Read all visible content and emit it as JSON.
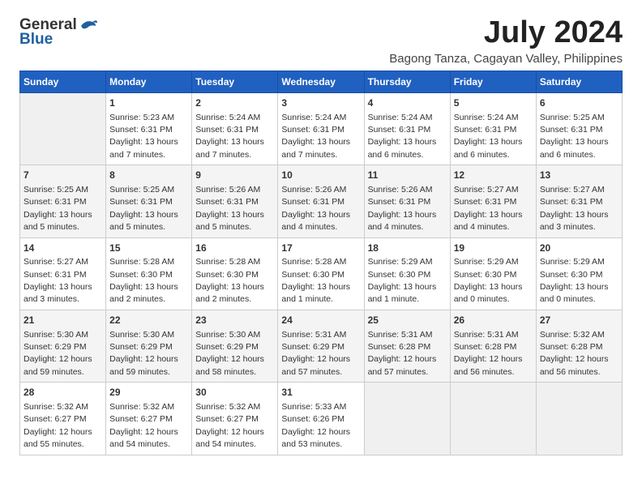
{
  "logo": {
    "general": "General",
    "blue": "Blue"
  },
  "title": "July 2024",
  "subtitle": "Bagong Tanza, Cagayan Valley, Philippines",
  "days_of_week": [
    "Sunday",
    "Monday",
    "Tuesday",
    "Wednesday",
    "Thursday",
    "Friday",
    "Saturday"
  ],
  "weeks": [
    [
      {
        "day": "",
        "sunrise": "",
        "sunset": "",
        "daylight": ""
      },
      {
        "day": "1",
        "sunrise": "Sunrise: 5:23 AM",
        "sunset": "Sunset: 6:31 PM",
        "daylight": "Daylight: 13 hours and 7 minutes."
      },
      {
        "day": "2",
        "sunrise": "Sunrise: 5:24 AM",
        "sunset": "Sunset: 6:31 PM",
        "daylight": "Daylight: 13 hours and 7 minutes."
      },
      {
        "day": "3",
        "sunrise": "Sunrise: 5:24 AM",
        "sunset": "Sunset: 6:31 PM",
        "daylight": "Daylight: 13 hours and 7 minutes."
      },
      {
        "day": "4",
        "sunrise": "Sunrise: 5:24 AM",
        "sunset": "Sunset: 6:31 PM",
        "daylight": "Daylight: 13 hours and 6 minutes."
      },
      {
        "day": "5",
        "sunrise": "Sunrise: 5:24 AM",
        "sunset": "Sunset: 6:31 PM",
        "daylight": "Daylight: 13 hours and 6 minutes."
      },
      {
        "day": "6",
        "sunrise": "Sunrise: 5:25 AM",
        "sunset": "Sunset: 6:31 PM",
        "daylight": "Daylight: 13 hours and 6 minutes."
      }
    ],
    [
      {
        "day": "7",
        "sunrise": "Sunrise: 5:25 AM",
        "sunset": "Sunset: 6:31 PM",
        "daylight": "Daylight: 13 hours and 5 minutes."
      },
      {
        "day": "8",
        "sunrise": "Sunrise: 5:25 AM",
        "sunset": "Sunset: 6:31 PM",
        "daylight": "Daylight: 13 hours and 5 minutes."
      },
      {
        "day": "9",
        "sunrise": "Sunrise: 5:26 AM",
        "sunset": "Sunset: 6:31 PM",
        "daylight": "Daylight: 13 hours and 5 minutes."
      },
      {
        "day": "10",
        "sunrise": "Sunrise: 5:26 AM",
        "sunset": "Sunset: 6:31 PM",
        "daylight": "Daylight: 13 hours and 4 minutes."
      },
      {
        "day": "11",
        "sunrise": "Sunrise: 5:26 AM",
        "sunset": "Sunset: 6:31 PM",
        "daylight": "Daylight: 13 hours and 4 minutes."
      },
      {
        "day": "12",
        "sunrise": "Sunrise: 5:27 AM",
        "sunset": "Sunset: 6:31 PM",
        "daylight": "Daylight: 13 hours and 4 minutes."
      },
      {
        "day": "13",
        "sunrise": "Sunrise: 5:27 AM",
        "sunset": "Sunset: 6:31 PM",
        "daylight": "Daylight: 13 hours and 3 minutes."
      }
    ],
    [
      {
        "day": "14",
        "sunrise": "Sunrise: 5:27 AM",
        "sunset": "Sunset: 6:31 PM",
        "daylight": "Daylight: 13 hours and 3 minutes."
      },
      {
        "day": "15",
        "sunrise": "Sunrise: 5:28 AM",
        "sunset": "Sunset: 6:30 PM",
        "daylight": "Daylight: 13 hours and 2 minutes."
      },
      {
        "day": "16",
        "sunrise": "Sunrise: 5:28 AM",
        "sunset": "Sunset: 6:30 PM",
        "daylight": "Daylight: 13 hours and 2 minutes."
      },
      {
        "day": "17",
        "sunrise": "Sunrise: 5:28 AM",
        "sunset": "Sunset: 6:30 PM",
        "daylight": "Daylight: 13 hours and 1 minute."
      },
      {
        "day": "18",
        "sunrise": "Sunrise: 5:29 AM",
        "sunset": "Sunset: 6:30 PM",
        "daylight": "Daylight: 13 hours and 1 minute."
      },
      {
        "day": "19",
        "sunrise": "Sunrise: 5:29 AM",
        "sunset": "Sunset: 6:30 PM",
        "daylight": "Daylight: 13 hours and 0 minutes."
      },
      {
        "day": "20",
        "sunrise": "Sunrise: 5:29 AM",
        "sunset": "Sunset: 6:30 PM",
        "daylight": "Daylight: 13 hours and 0 minutes."
      }
    ],
    [
      {
        "day": "21",
        "sunrise": "Sunrise: 5:30 AM",
        "sunset": "Sunset: 6:29 PM",
        "daylight": "Daylight: 12 hours and 59 minutes."
      },
      {
        "day": "22",
        "sunrise": "Sunrise: 5:30 AM",
        "sunset": "Sunset: 6:29 PM",
        "daylight": "Daylight: 12 hours and 59 minutes."
      },
      {
        "day": "23",
        "sunrise": "Sunrise: 5:30 AM",
        "sunset": "Sunset: 6:29 PM",
        "daylight": "Daylight: 12 hours and 58 minutes."
      },
      {
        "day": "24",
        "sunrise": "Sunrise: 5:31 AM",
        "sunset": "Sunset: 6:29 PM",
        "daylight": "Daylight: 12 hours and 57 minutes."
      },
      {
        "day": "25",
        "sunrise": "Sunrise: 5:31 AM",
        "sunset": "Sunset: 6:28 PM",
        "daylight": "Daylight: 12 hours and 57 minutes."
      },
      {
        "day": "26",
        "sunrise": "Sunrise: 5:31 AM",
        "sunset": "Sunset: 6:28 PM",
        "daylight": "Daylight: 12 hours and 56 minutes."
      },
      {
        "day": "27",
        "sunrise": "Sunrise: 5:32 AM",
        "sunset": "Sunset: 6:28 PM",
        "daylight": "Daylight: 12 hours and 56 minutes."
      }
    ],
    [
      {
        "day": "28",
        "sunrise": "Sunrise: 5:32 AM",
        "sunset": "Sunset: 6:27 PM",
        "daylight": "Daylight: 12 hours and 55 minutes."
      },
      {
        "day": "29",
        "sunrise": "Sunrise: 5:32 AM",
        "sunset": "Sunset: 6:27 PM",
        "daylight": "Daylight: 12 hours and 54 minutes."
      },
      {
        "day": "30",
        "sunrise": "Sunrise: 5:32 AM",
        "sunset": "Sunset: 6:27 PM",
        "daylight": "Daylight: 12 hours and 54 minutes."
      },
      {
        "day": "31",
        "sunrise": "Sunrise: 5:33 AM",
        "sunset": "Sunset: 6:26 PM",
        "daylight": "Daylight: 12 hours and 53 minutes."
      },
      {
        "day": "",
        "sunrise": "",
        "sunset": "",
        "daylight": ""
      },
      {
        "day": "",
        "sunrise": "",
        "sunset": "",
        "daylight": ""
      },
      {
        "day": "",
        "sunrise": "",
        "sunset": "",
        "daylight": ""
      }
    ]
  ]
}
